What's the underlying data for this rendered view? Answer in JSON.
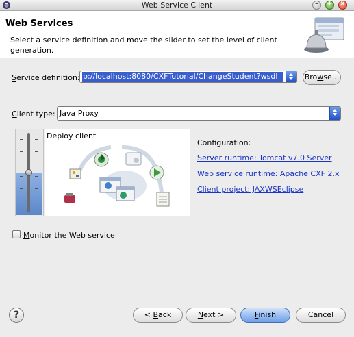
{
  "window": {
    "title": "Web Service Client"
  },
  "header": {
    "title": "Web Services",
    "description": "Select a service definition and move the slider to set the level of client generation.",
    "icon": "wizard-bell-icon"
  },
  "service_definition": {
    "label_mnemonic": "S",
    "label_rest": "ervice definition:",
    "value": "p://localhost:8080/CXFTutorial/ChangeStudent?wsdl",
    "browse_label_pre": "Bro",
    "browse_label_mnemonic": "w",
    "browse_label_post": "se..."
  },
  "client_type": {
    "label_mnemonic": "C",
    "label_rest": "lient type:",
    "value": "Java Proxy"
  },
  "slider": {
    "level_label": "Deploy client",
    "level_fraction": 0.5
  },
  "configuration": {
    "title": "Configuration:",
    "server_runtime": "Server runtime: Tomcat v7.0 Server",
    "ws_runtime": "Web service runtime: Apache CXF 2.x",
    "client_project": "Client project: JAXWSEclipse"
  },
  "monitor": {
    "label_mnemonic": "M",
    "label_rest": "onitor the Web service",
    "checked": false
  },
  "footer": {
    "help_icon": "help-icon",
    "back_pre": "< ",
    "back_mnemonic": "B",
    "back_post": "ack",
    "next_mnemonic": "N",
    "next_post": "ext >",
    "finish_mnemonic": "F",
    "finish_post": "inish",
    "cancel_label": "Cancel"
  },
  "colors": {
    "selection": "#3a5fcd",
    "link": "#1a35c4",
    "default_button": "#6f9fe6"
  }
}
